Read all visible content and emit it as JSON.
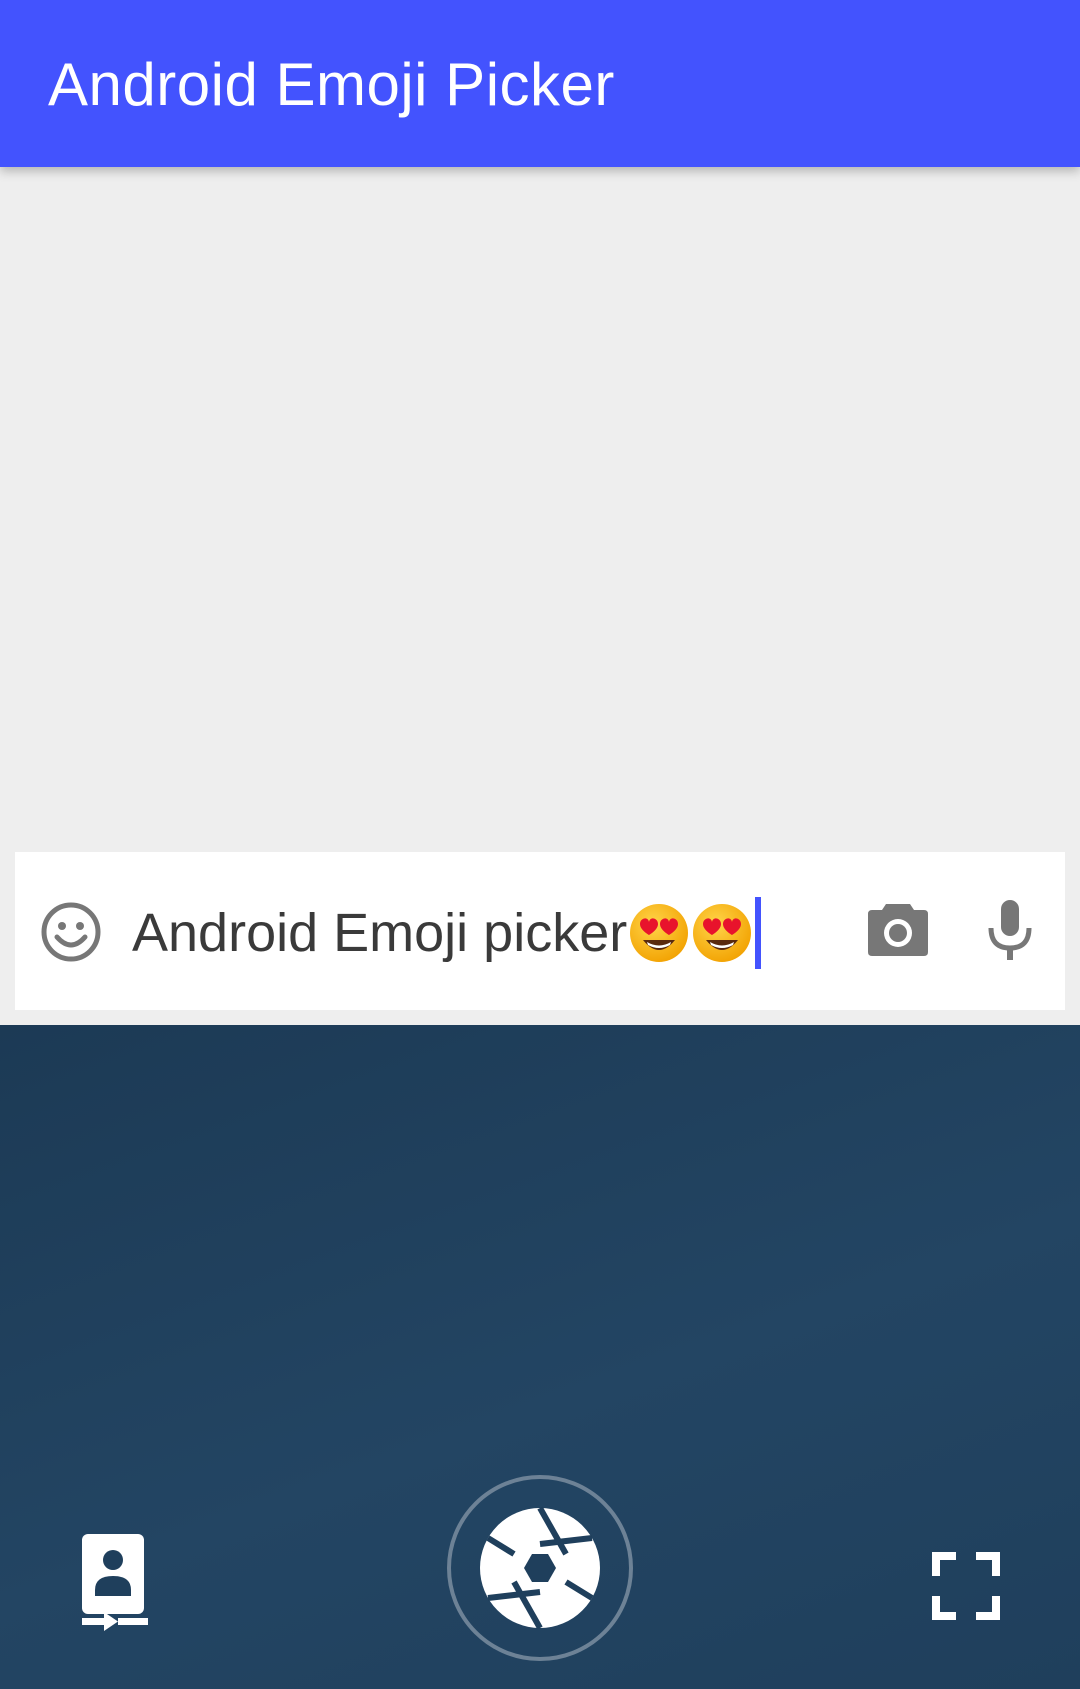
{
  "colors": {
    "app_bar": "#4353fe",
    "cursor": "#4353fe",
    "icon_grey": "#777777",
    "camera_bg": "#1f3f5c"
  },
  "app_bar": {
    "title": "Android Emoji Picker"
  },
  "input": {
    "value_text": "Android Emoji picker",
    "emojis": [
      "😍",
      "😍"
    ],
    "emoji_icon": "smiling-face-with-heart-eyes",
    "left_icon": "smiley-face-icon",
    "right_icons": [
      "camera-icon",
      "microphone-icon"
    ]
  },
  "camera_panel": {
    "icons": [
      "switch-camera-icon",
      "shutter-aperture-icon",
      "fullscreen-icon"
    ]
  }
}
